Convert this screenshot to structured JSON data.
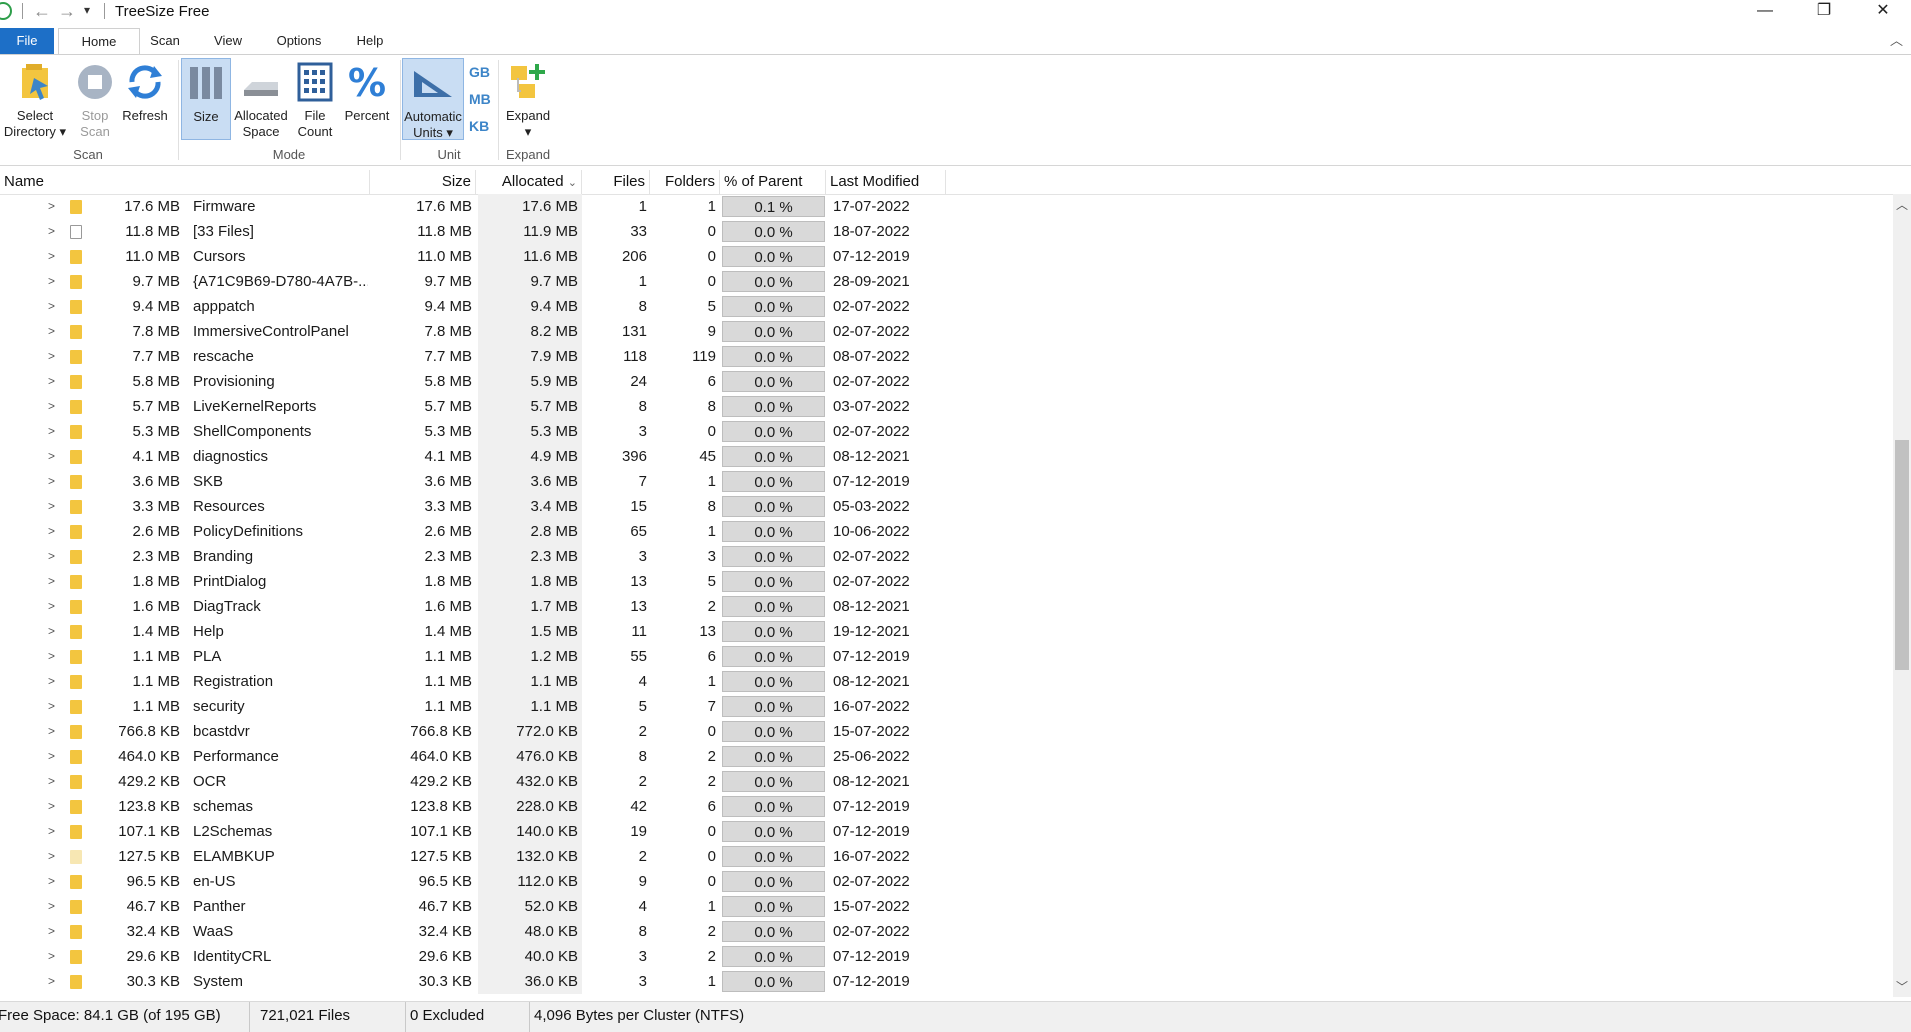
{
  "window": {
    "title": "TreeSize Free",
    "minimize": "—",
    "restore": "❐",
    "close": "✕"
  },
  "menu": {
    "items": [
      "File",
      "Home",
      "Scan",
      "View",
      "Options",
      "Help"
    ]
  },
  "ribbon": {
    "select_directory": {
      "line1": "Select",
      "line2": "Directory"
    },
    "stop_scan": {
      "line1": "Stop",
      "line2": "Scan"
    },
    "refresh": "Refresh",
    "size": "Size",
    "allocated_space": {
      "line1": "Allocated",
      "line2": "Space"
    },
    "file_count": {
      "line1": "File",
      "line2": "Count"
    },
    "percent": "Percent",
    "automatic_units": {
      "line1": "Automatic",
      "line2": "Units"
    },
    "unit_gb": "GB",
    "unit_mb": "MB",
    "unit_kb": "KB",
    "expand": "Expand",
    "groups": {
      "scan": "Scan",
      "mode": "Mode",
      "unit": "Unit",
      "expand": "Expand"
    },
    "colors": {
      "active_bg": "#c9ddf3",
      "accent": "#1d6fc7"
    }
  },
  "columns": {
    "name": "Name",
    "size": "Size",
    "allocated": "Allocated",
    "files": "Files",
    "folders": "Folders",
    "percent": "% of Parent (...",
    "modified": "Last Modified"
  },
  "rows": [
    {
      "size_label": "17.6 MB",
      "name": "Firmware",
      "size": "17.6 MB",
      "allocated": "17.6 MB",
      "files": "1",
      "folders": "1",
      "pct": "0.1 %",
      "modified": "17-07-2022",
      "icon": "folder"
    },
    {
      "size_label": "11.8 MB",
      "name": "[33 Files]",
      "size": "11.8 MB",
      "allocated": "11.9 MB",
      "files": "33",
      "folders": "0",
      "pct": "0.0 %",
      "modified": "18-07-2022",
      "icon": "file"
    },
    {
      "size_label": "11.0 MB",
      "name": "Cursors",
      "size": "11.0 MB",
      "allocated": "11.6 MB",
      "files": "206",
      "folders": "0",
      "pct": "0.0 %",
      "modified": "07-12-2019",
      "icon": "folder"
    },
    {
      "size_label": "9.7 MB",
      "name": "{A71C9B69-D780-4A7B-...",
      "size": "9.7 MB",
      "allocated": "9.7 MB",
      "files": "1",
      "folders": "0",
      "pct": "0.0 %",
      "modified": "28-09-2021",
      "icon": "folder"
    },
    {
      "size_label": "9.4 MB",
      "name": "apppatch",
      "size": "9.4 MB",
      "allocated": "9.4 MB",
      "files": "8",
      "folders": "5",
      "pct": "0.0 %",
      "modified": "02-07-2022",
      "icon": "folder"
    },
    {
      "size_label": "7.8 MB",
      "name": "ImmersiveControlPanel",
      "size": "7.8 MB",
      "allocated": "8.2 MB",
      "files": "131",
      "folders": "9",
      "pct": "0.0 %",
      "modified": "02-07-2022",
      "icon": "folder"
    },
    {
      "size_label": "7.7 MB",
      "name": "rescache",
      "size": "7.7 MB",
      "allocated": "7.9 MB",
      "files": "118",
      "folders": "119",
      "pct": "0.0 %",
      "modified": "08-07-2022",
      "icon": "folder"
    },
    {
      "size_label": "5.8 MB",
      "name": "Provisioning",
      "size": "5.8 MB",
      "allocated": "5.9 MB",
      "files": "24",
      "folders": "6",
      "pct": "0.0 %",
      "modified": "02-07-2022",
      "icon": "folder"
    },
    {
      "size_label": "5.7 MB",
      "name": "LiveKernelReports",
      "size": "5.7 MB",
      "allocated": "5.7 MB",
      "files": "8",
      "folders": "8",
      "pct": "0.0 %",
      "modified": "03-07-2022",
      "icon": "folder"
    },
    {
      "size_label": "5.3 MB",
      "name": "ShellComponents",
      "size": "5.3 MB",
      "allocated": "5.3 MB",
      "files": "3",
      "folders": "0",
      "pct": "0.0 %",
      "modified": "02-07-2022",
      "icon": "folder"
    },
    {
      "size_label": "4.1 MB",
      "name": "diagnostics",
      "size": "4.1 MB",
      "allocated": "4.9 MB",
      "files": "396",
      "folders": "45",
      "pct": "0.0 %",
      "modified": "08-12-2021",
      "icon": "folder"
    },
    {
      "size_label": "3.6 MB",
      "name": "SKB",
      "size": "3.6 MB",
      "allocated": "3.6 MB",
      "files": "7",
      "folders": "1",
      "pct": "0.0 %",
      "modified": "07-12-2019",
      "icon": "folder"
    },
    {
      "size_label": "3.3 MB",
      "name": "Resources",
      "size": "3.3 MB",
      "allocated": "3.4 MB",
      "files": "15",
      "folders": "8",
      "pct": "0.0 %",
      "modified": "05-03-2022",
      "icon": "folder"
    },
    {
      "size_label": "2.6 MB",
      "name": "PolicyDefinitions",
      "size": "2.6 MB",
      "allocated": "2.8 MB",
      "files": "65",
      "folders": "1",
      "pct": "0.0 %",
      "modified": "10-06-2022",
      "icon": "folder"
    },
    {
      "size_label": "2.3 MB",
      "name": "Branding",
      "size": "2.3 MB",
      "allocated": "2.3 MB",
      "files": "3",
      "folders": "3",
      "pct": "0.0 %",
      "modified": "02-07-2022",
      "icon": "folder"
    },
    {
      "size_label": "1.8 MB",
      "name": "PrintDialog",
      "size": "1.8 MB",
      "allocated": "1.8 MB",
      "files": "13",
      "folders": "5",
      "pct": "0.0 %",
      "modified": "02-07-2022",
      "icon": "folder"
    },
    {
      "size_label": "1.6 MB",
      "name": "DiagTrack",
      "size": "1.6 MB",
      "allocated": "1.7 MB",
      "files": "13",
      "folders": "2",
      "pct": "0.0 %",
      "modified": "08-12-2021",
      "icon": "folder"
    },
    {
      "size_label": "1.4 MB",
      "name": "Help",
      "size": "1.4 MB",
      "allocated": "1.5 MB",
      "files": "11",
      "folders": "13",
      "pct": "0.0 %",
      "modified": "19-12-2021",
      "icon": "folder"
    },
    {
      "size_label": "1.1 MB",
      "name": "PLA",
      "size": "1.1 MB",
      "allocated": "1.2 MB",
      "files": "55",
      "folders": "6",
      "pct": "0.0 %",
      "modified": "07-12-2019",
      "icon": "folder"
    },
    {
      "size_label": "1.1 MB",
      "name": "Registration",
      "size": "1.1 MB",
      "allocated": "1.1 MB",
      "files": "4",
      "folders": "1",
      "pct": "0.0 %",
      "modified": "08-12-2021",
      "icon": "folder"
    },
    {
      "size_label": "1.1 MB",
      "name": "security",
      "size": "1.1 MB",
      "allocated": "1.1 MB",
      "files": "5",
      "folders": "7",
      "pct": "0.0 %",
      "modified": "16-07-2022",
      "icon": "folder"
    },
    {
      "size_label": "766.8 KB",
      "name": "bcastdvr",
      "size": "766.8 KB",
      "allocated": "772.0 KB",
      "files": "2",
      "folders": "0",
      "pct": "0.0 %",
      "modified": "15-07-2022",
      "icon": "folder"
    },
    {
      "size_label": "464.0 KB",
      "name": "Performance",
      "size": "464.0 KB",
      "allocated": "476.0 KB",
      "files": "8",
      "folders": "2",
      "pct": "0.0 %",
      "modified": "25-06-2022",
      "icon": "folder"
    },
    {
      "size_label": "429.2 KB",
      "name": "OCR",
      "size": "429.2 KB",
      "allocated": "432.0 KB",
      "files": "2",
      "folders": "2",
      "pct": "0.0 %",
      "modified": "08-12-2021",
      "icon": "folder"
    },
    {
      "size_label": "123.8 KB",
      "name": "schemas",
      "size": "123.8 KB",
      "allocated": "228.0 KB",
      "files": "42",
      "folders": "6",
      "pct": "0.0 %",
      "modified": "07-12-2019",
      "icon": "folder"
    },
    {
      "size_label": "107.1 KB",
      "name": "L2Schemas",
      "size": "107.1 KB",
      "allocated": "140.0 KB",
      "files": "19",
      "folders": "0",
      "pct": "0.0 %",
      "modified": "07-12-2019",
      "icon": "folder"
    },
    {
      "size_label": "127.5 KB",
      "name": "ELAMBKUP",
      "size": "127.5 KB",
      "allocated": "132.0 KB",
      "files": "2",
      "folders": "0",
      "pct": "0.0 %",
      "modified": "16-07-2022",
      "icon": "folder-light"
    },
    {
      "size_label": "96.5 KB",
      "name": "en-US",
      "size": "96.5 KB",
      "allocated": "112.0 KB",
      "files": "9",
      "folders": "0",
      "pct": "0.0 %",
      "modified": "02-07-2022",
      "icon": "folder"
    },
    {
      "size_label": "46.7 KB",
      "name": "Panther",
      "size": "46.7 KB",
      "allocated": "52.0 KB",
      "files": "4",
      "folders": "1",
      "pct": "0.0 %",
      "modified": "15-07-2022",
      "icon": "folder"
    },
    {
      "size_label": "32.4 KB",
      "name": "WaaS",
      "size": "32.4 KB",
      "allocated": "48.0 KB",
      "files": "8",
      "folders": "2",
      "pct": "0.0 %",
      "modified": "02-07-2022",
      "icon": "folder"
    },
    {
      "size_label": "29.6 KB",
      "name": "IdentityCRL",
      "size": "29.6 KB",
      "allocated": "40.0 KB",
      "files": "3",
      "folders": "2",
      "pct": "0.0 %",
      "modified": "07-12-2019",
      "icon": "folder"
    },
    {
      "size_label": "30.3 KB",
      "name": "System",
      "size": "30.3 KB",
      "allocated": "36.0 KB",
      "files": "3",
      "folders": "1",
      "pct": "0.0 %",
      "modified": "07-12-2019",
      "icon": "folder"
    }
  ],
  "status": {
    "free_space": "Free Space: 84.1 GB  (of 195 GB)",
    "files": "721,021 Files",
    "excluded": "0 Excluded",
    "cluster": "4,096 Bytes per Cluster (NTFS)"
  }
}
